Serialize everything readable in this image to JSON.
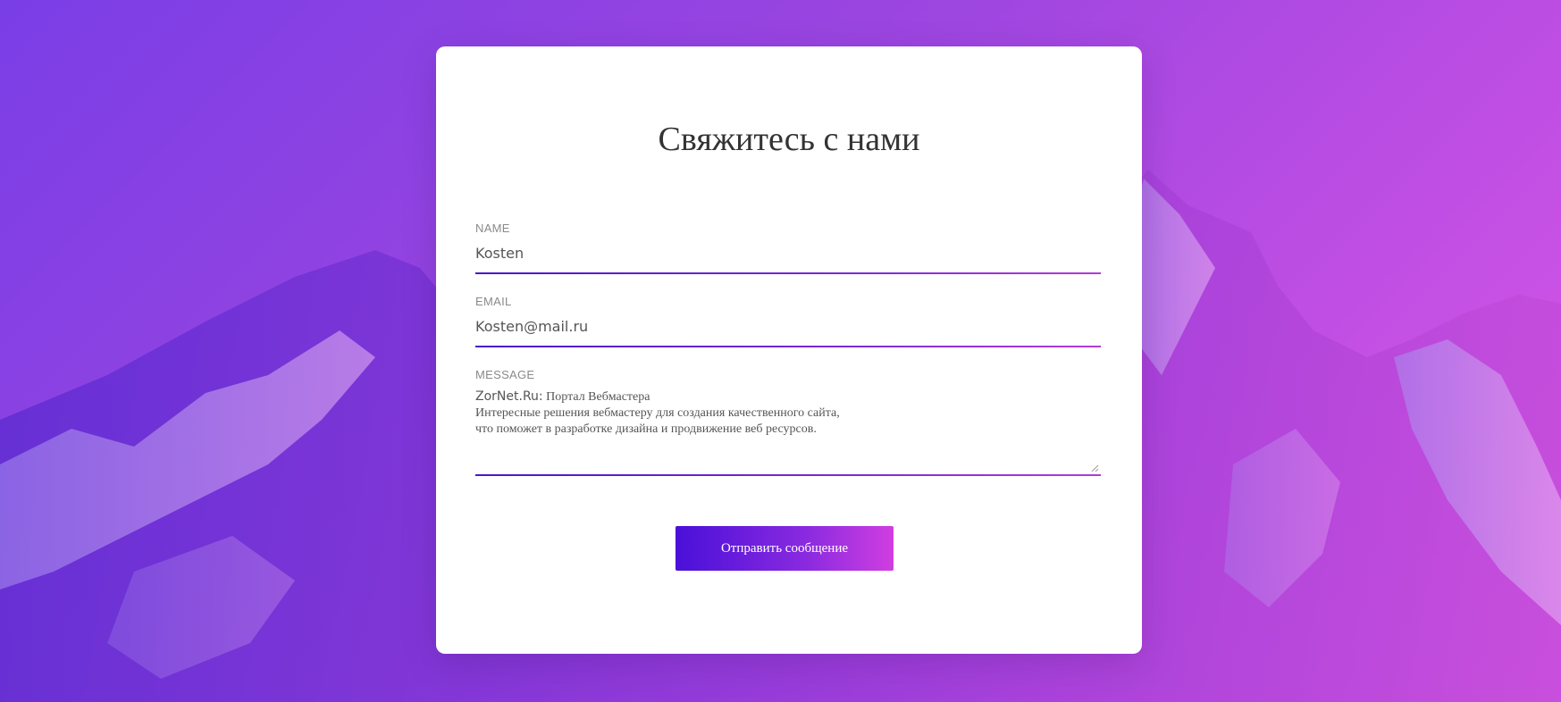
{
  "page": {
    "title": "Свяжитесь с нами"
  },
  "form": {
    "name": {
      "label": "NAME",
      "value": "Kosten"
    },
    "email": {
      "label": "EMAIL",
      "value": "Kosten@mail.ru"
    },
    "message": {
      "label": "MESSAGE",
      "line1_prefix": "ZorNet.Ru:",
      "line1_rest": " Портал Вебмастера",
      "line2": "Интересные решения вебмастеру для создания качественного сайта,",
      "line3": "что поможет в разработке дизайна и продвижение веб ресурсов."
    },
    "submit_label": "Отправить сообщение"
  },
  "colors": {
    "accent_start": "#4a10d8",
    "accent_end": "#d03ee0",
    "background": "#9b45e0"
  }
}
